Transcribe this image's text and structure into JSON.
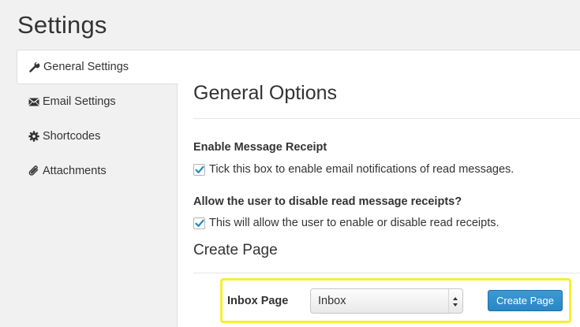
{
  "page": {
    "title": "Settings"
  },
  "sidebar": {
    "items": [
      {
        "label": "General Settings",
        "icon": "wrench-icon",
        "active": true
      },
      {
        "label": "Email Settings",
        "icon": "envelope-icon",
        "active": false
      },
      {
        "label": "Shortcodes",
        "icon": "gear-icon",
        "active": false
      },
      {
        "label": "Attachments",
        "icon": "paperclip-icon",
        "active": false
      }
    ]
  },
  "main": {
    "section_title": "General Options",
    "options": [
      {
        "label": "Enable Message Receipt",
        "checkbox_text": "Tick this box to enable email notifications of read messages.",
        "checked": true
      },
      {
        "label": "Allow the user to disable read message receipts?",
        "checkbox_text": "This will allow the user to enable or disable read receipts.",
        "checked": true
      }
    ],
    "create_page": {
      "title": "Create Page",
      "field_label": "Inbox Page",
      "select_value": "Inbox",
      "button_label": "Create Page"
    }
  },
  "colors": {
    "accent_button": "#2a87c4",
    "highlight_border": "#f5ef34",
    "checkmark": "#1e8cbe"
  }
}
